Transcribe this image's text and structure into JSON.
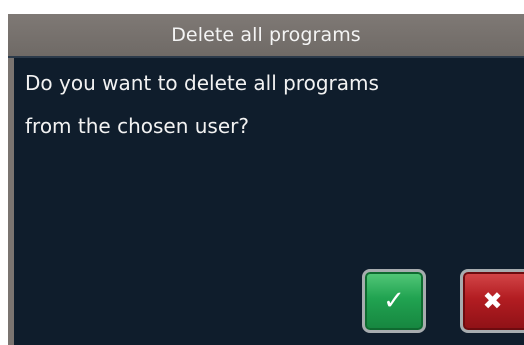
{
  "dialog": {
    "title": "Delete all programs",
    "message_lines": [
      "Do you want to delete all programs",
      "from the chosen user?"
    ],
    "confirm_icon": "check-icon",
    "cancel_icon": "close-icon",
    "confirm_glyph": "✓",
    "cancel_glyph": "✖"
  },
  "colors": {
    "background": "#0f1d2c",
    "titlebar": "#77716d",
    "confirm": "#21a351",
    "cancel": "#b31d22"
  }
}
